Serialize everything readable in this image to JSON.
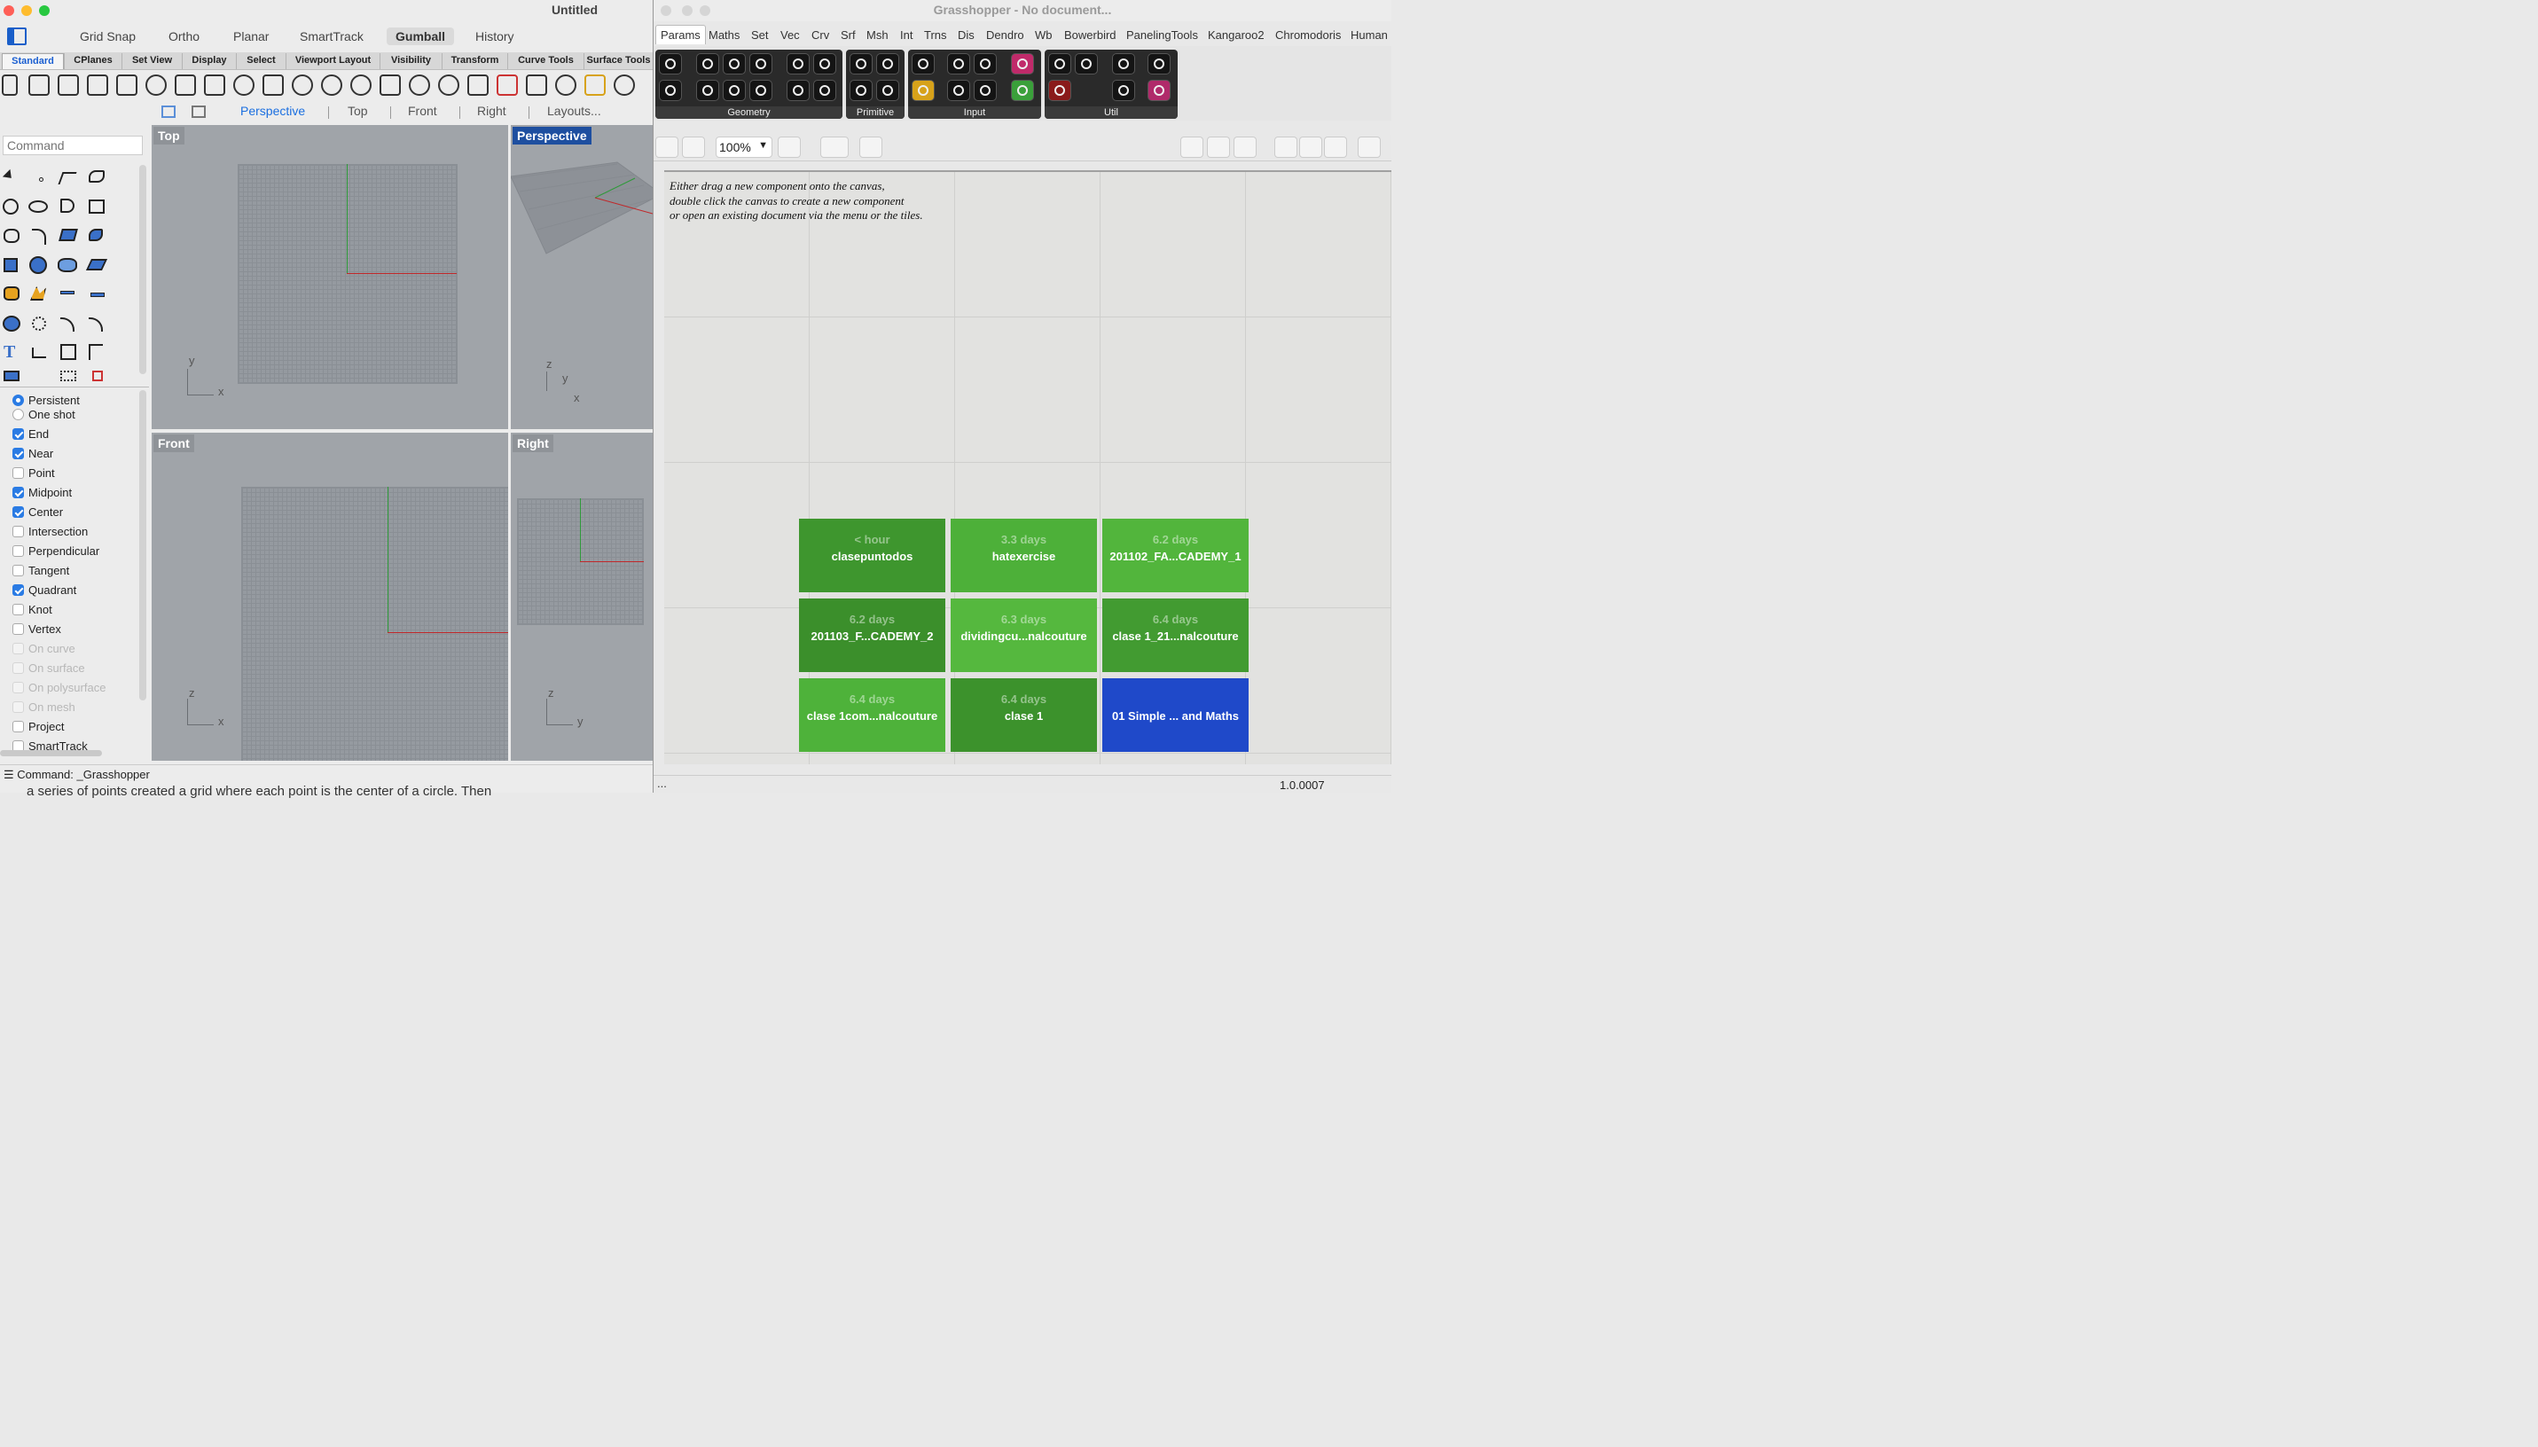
{
  "rhino": {
    "title": "Untitled",
    "mode_bar": [
      "Grid Snap",
      "Ortho",
      "Planar",
      "SmartTrack",
      "Gumball",
      "History"
    ],
    "mode_active": "Gumball",
    "tabs": [
      "Standard",
      "CPlanes",
      "Set View",
      "Display",
      "Select",
      "Viewport Layout",
      "Visibility",
      "Transform",
      "Curve Tools",
      "Surface Tools"
    ],
    "active_tab": "Standard",
    "viewport_tabs": [
      "Perspective",
      "Top",
      "Front",
      "Right",
      "Layouts..."
    ],
    "active_viewport_tab": "Perspective",
    "command_placeholder": "Command",
    "viewports": {
      "top": {
        "label": "Top",
        "axis1": "y",
        "axis2": "x"
      },
      "perspective": {
        "label": "Perspective",
        "axis_z": "z",
        "axis_y": "y",
        "axis_x": "x"
      },
      "front": {
        "label": "Front",
        "axis1": "z",
        "axis2": "x"
      },
      "right": {
        "label": "Right",
        "axis1": "z",
        "axis2": "y"
      }
    },
    "osnap_mode": [
      {
        "label": "Persistent",
        "selected": true
      },
      {
        "label": "One shot",
        "selected": false
      }
    ],
    "osnaps": [
      {
        "label": "End",
        "checked": true,
        "enabled": true
      },
      {
        "label": "Near",
        "checked": true,
        "enabled": true
      },
      {
        "label": "Point",
        "checked": false,
        "enabled": true
      },
      {
        "label": "Midpoint",
        "checked": true,
        "enabled": true
      },
      {
        "label": "Center",
        "checked": true,
        "enabled": true
      },
      {
        "label": "Intersection",
        "checked": false,
        "enabled": true
      },
      {
        "label": "Perpendicular",
        "checked": false,
        "enabled": true
      },
      {
        "label": "Tangent",
        "checked": false,
        "enabled": true
      },
      {
        "label": "Quadrant",
        "checked": true,
        "enabled": true
      },
      {
        "label": "Knot",
        "checked": false,
        "enabled": true
      },
      {
        "label": "Vertex",
        "checked": false,
        "enabled": true
      },
      {
        "label": "On curve",
        "checked": false,
        "enabled": false
      },
      {
        "label": "On surface",
        "checked": false,
        "enabled": false
      },
      {
        "label": "On polysurface",
        "checked": false,
        "enabled": false
      },
      {
        "label": "On mesh",
        "checked": false,
        "enabled": false
      },
      {
        "label": "Project",
        "checked": false,
        "enabled": true
      },
      {
        "label": "SmartTrack",
        "checked": false,
        "enabled": true
      }
    ],
    "status_command": "Command: _Grasshopper",
    "below_text": "a series of points created a grid where each point is the center of a circle. Then"
  },
  "gh": {
    "title": "Grasshopper - No document...",
    "tabs": [
      "Params",
      "Maths",
      "Set",
      "Vec",
      "Crv",
      "Srf",
      "Msh",
      "Int",
      "Trns",
      "Dis",
      "Dendro",
      "Wb",
      "Bowerbird",
      "PanelingTools",
      "Kangaroo2",
      "Chromodoris",
      "Human"
    ],
    "active_tab": "Params",
    "groups": [
      "Geometry",
      "Primitive",
      "Input",
      "Util"
    ],
    "zoom": "100%",
    "hint_lines": [
      "Either drag a new component onto the canvas,",
      "double click the canvas to create a new component",
      "or open an existing document via the menu or the tiles."
    ],
    "tiles": [
      {
        "age": "< hour",
        "name": "clasepuntodos",
        "color": "#3e962e"
      },
      {
        "age": "3.3 days",
        "name": "hatexercise",
        "color": "#4db039"
      },
      {
        "age": "6.2 days",
        "name": "201102_FA...CADEMY_1",
        "color": "#52b53c"
      },
      {
        "age": "6.2 days",
        "name": "201103_F...CADEMY_2",
        "color": "#3b8f2b"
      },
      {
        "age": "6.3 days",
        "name": "dividingcu...nalcouture",
        "color": "#55b83e"
      },
      {
        "age": "6.4 days",
        "name": "clase 1_21...nalcouture",
        "color": "#429b31"
      },
      {
        "age": "6.4 days",
        "name": "clase 1com...nalcouture",
        "color": "#4eb23a"
      },
      {
        "age": "6.4 days",
        "name": "clase 1",
        "color": "#3c922c"
      },
      {
        "age": "",
        "name": "01 Simple ... and Maths",
        "color": "#1f49c9"
      }
    ],
    "status_left": "...",
    "version": "1.0.0007"
  },
  "colors": {
    "accent_blue": "#1b6fe0",
    "axis_x": "#c0282a",
    "axis_y": "#2f9a3a",
    "checkbox_on": "#2a7be4"
  }
}
